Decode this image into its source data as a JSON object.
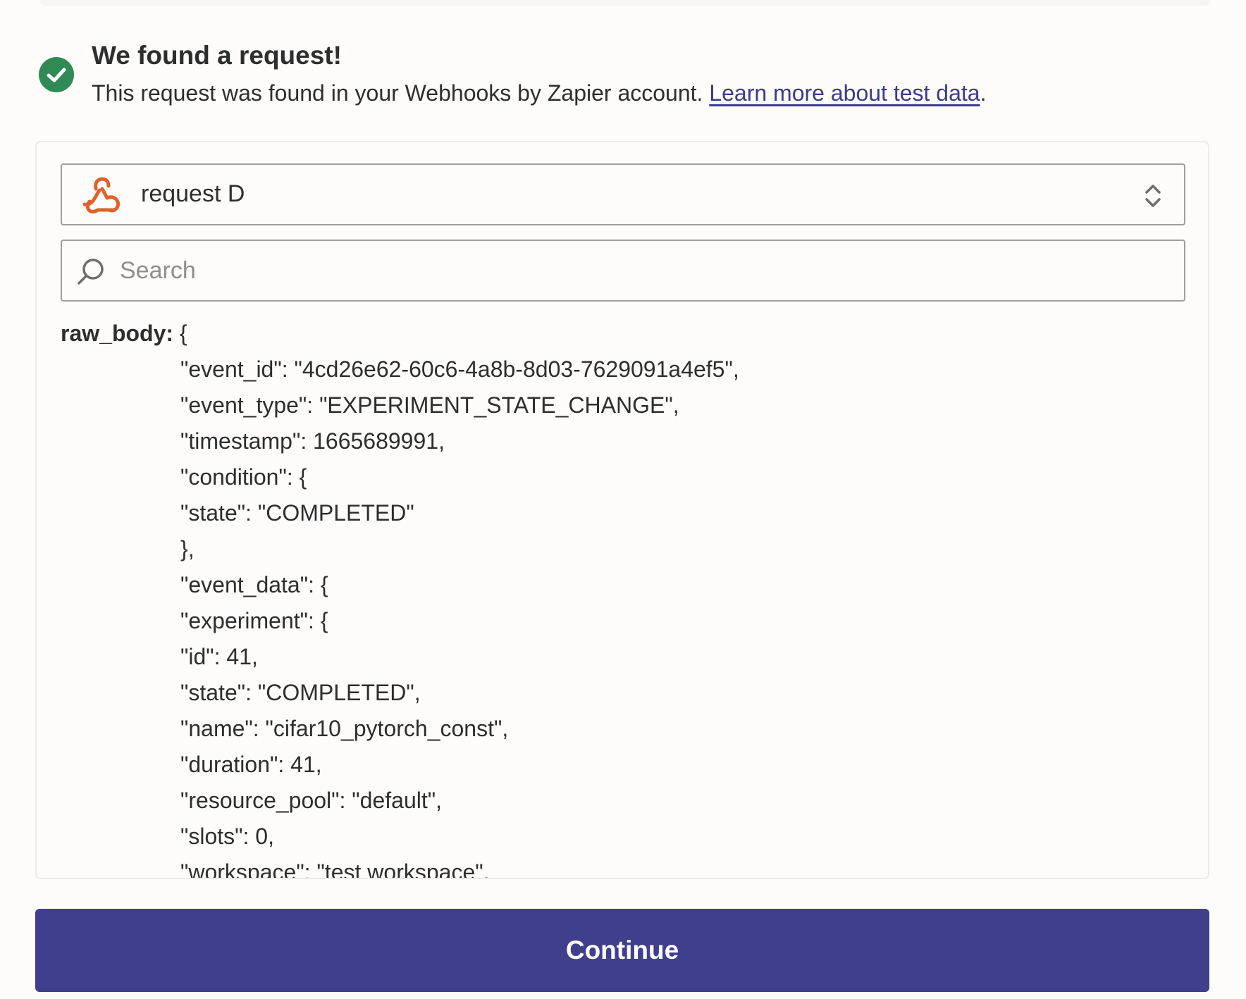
{
  "header": {
    "title": "We found a request!",
    "description": "This request was found in your Webhooks by Zapier account. ",
    "link_text": "Learn more about test data",
    "trailing": "."
  },
  "request_select": {
    "selected": "request D",
    "icon": "webhook-icon"
  },
  "search": {
    "placeholder": "Search",
    "value": ""
  },
  "raw_body": {
    "key": "raw_body:",
    "open": " {",
    "lines": [
      "\"event_id\": \"4cd26e62-60c6-4a8b-8d03-7629091a4ef5\",",
      "\"event_type\": \"EXPERIMENT_STATE_CHANGE\",",
      "\"timestamp\": 1665689991,",
      "\"condition\": {",
      "\"state\": \"COMPLETED\"",
      "},",
      "\"event_data\": {",
      "\"experiment\": {",
      "\"id\": 41,",
      "\"state\": \"COMPLETED\",",
      "\"name\": \"cifar10_pytorch_const\",",
      "\"duration\": 41,",
      "\"resource_pool\": \"default\",",
      "\"slots\": 0,",
      "\"workspace\": \"test workspace\","
    ]
  },
  "continue_button": {
    "label": "Continue"
  },
  "colors": {
    "accent": "#403f8d",
    "success": "#2f8a55",
    "webhook": "#e0612b",
    "link": "#3b3b8f"
  }
}
